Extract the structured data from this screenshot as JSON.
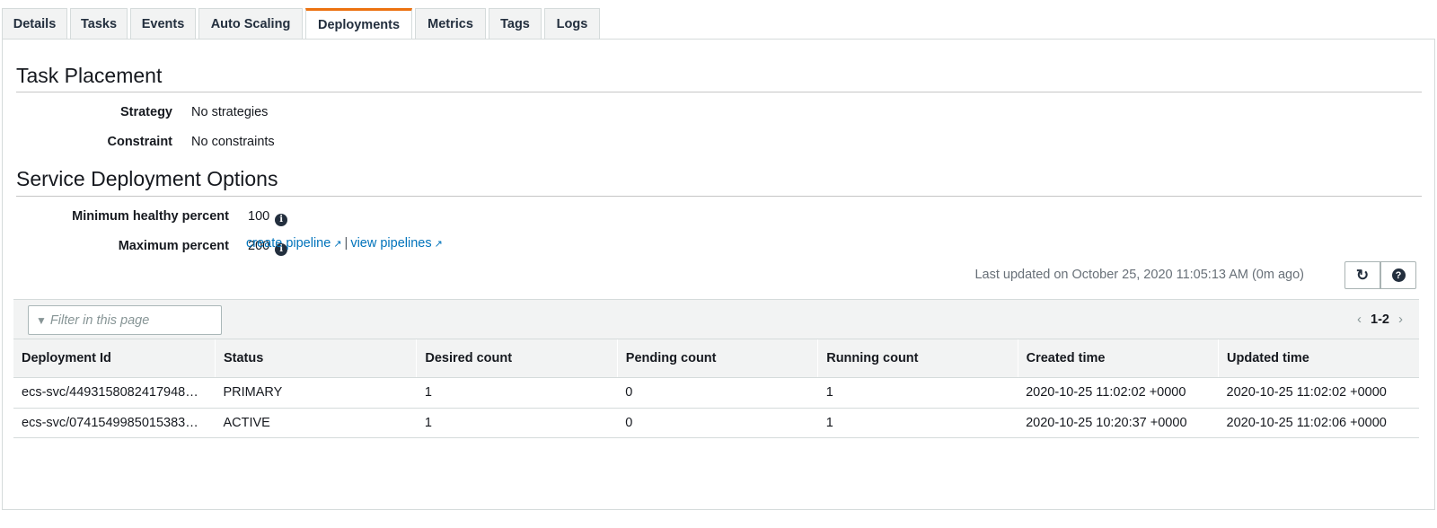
{
  "tabs": [
    {
      "label": "Details"
    },
    {
      "label": "Tasks"
    },
    {
      "label": "Events"
    },
    {
      "label": "Auto Scaling"
    },
    {
      "label": "Deployments",
      "active": true
    },
    {
      "label": "Metrics"
    },
    {
      "label": "Tags"
    },
    {
      "label": "Logs"
    }
  ],
  "task_placement": {
    "title": "Task Placement",
    "strategy_label": "Strategy",
    "strategy_value": "No strategies",
    "constraint_label": "Constraint",
    "constraint_value": "No constraints"
  },
  "deployment_options": {
    "title": "Service Deployment Options",
    "min_healthy_label": "Minimum healthy percent",
    "min_healthy_value": "100",
    "max_percent_label": "Maximum percent",
    "max_percent_value": "200",
    "create_pipeline": "create pipeline",
    "separator": "|",
    "view_pipelines": "view pipelines"
  },
  "status_bar": {
    "last_updated": "Last updated on October 25, 2020 11:05:13 AM (0m ago)",
    "refresh_icon": "refresh-icon",
    "help_icon": "help-icon"
  },
  "table": {
    "filter_placeholder": "Filter in this page",
    "page_range": "1-2",
    "columns": [
      "Deployment Id",
      "Status",
      "Desired count",
      "Pending count",
      "Running count",
      "Created time",
      "Updated time"
    ],
    "rows": [
      [
        "ecs-svc/4493158082417948…",
        "PRIMARY",
        "1",
        "0",
        "1",
        "2020-10-25 11:02:02 +0000",
        "2020-10-25 11:02:02 +0000"
      ],
      [
        "ecs-svc/0741549985015383…",
        "ACTIVE",
        "1",
        "0",
        "1",
        "2020-10-25 10:20:37 +0000",
        "2020-10-25 11:02:06 +0000"
      ]
    ]
  },
  "colors": {
    "active_tab_accent": "#ec7211",
    "link": "#0073bb",
    "header_bg": "#f2f3f3"
  }
}
